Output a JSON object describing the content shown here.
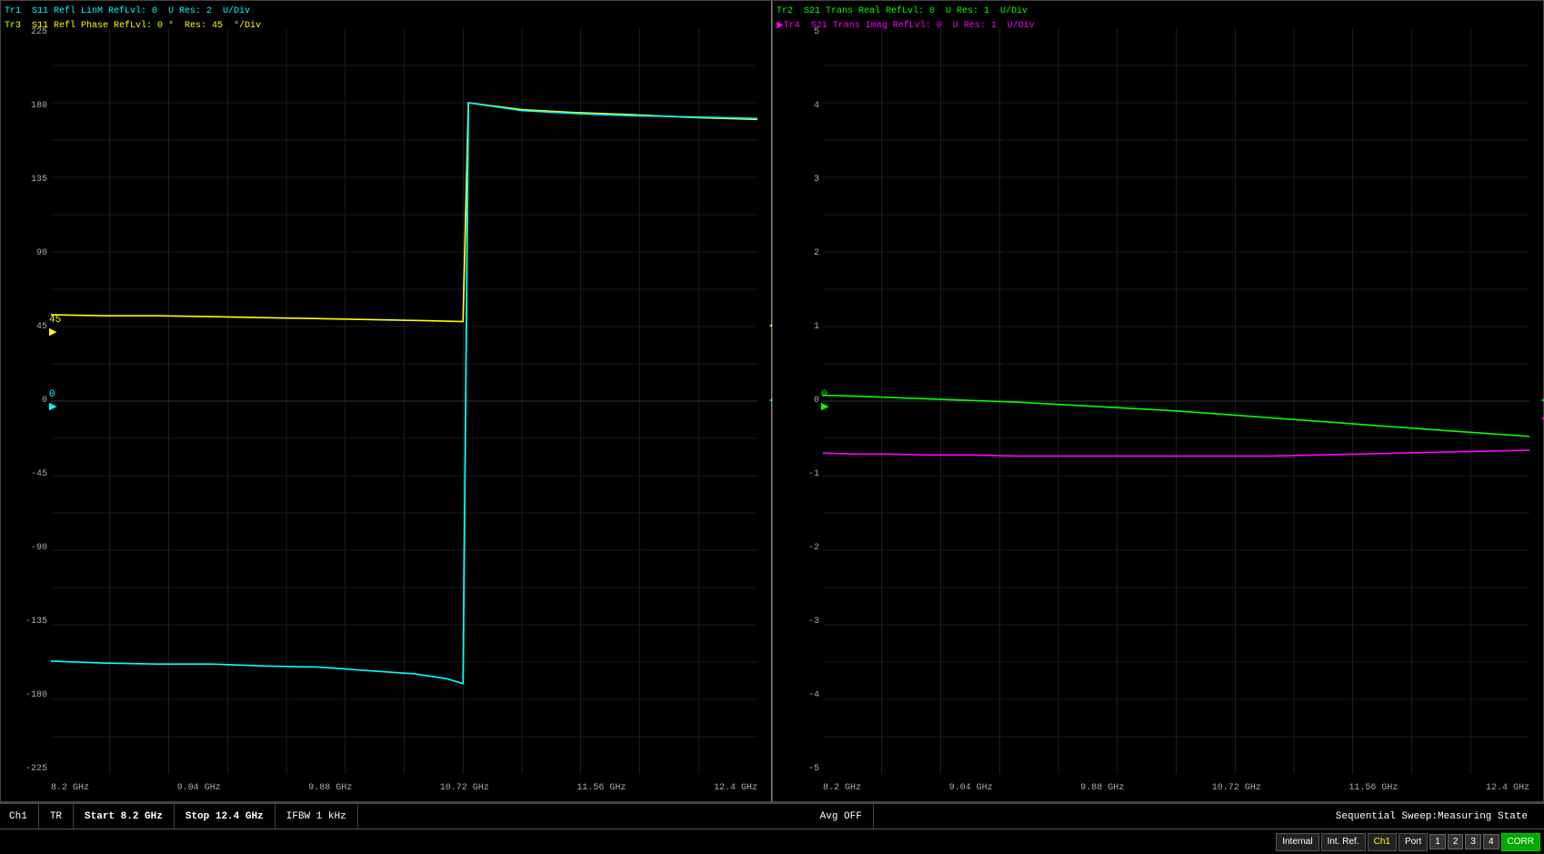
{
  "left_panel": {
    "traces": [
      {
        "id": "Tr1",
        "label": "S11 Refl LinM RefLvl: 0  U Res: 2  U/Div",
        "color": "#00ffff"
      },
      {
        "id": "Tr3",
        "label": "S11 Refl Phase RefLvl: 0 °  Res: 45  °/Div",
        "color": "#ffff00"
      }
    ],
    "y_labels": [
      "225",
      "180",
      "135",
      "90",
      "45",
      "0",
      "-45",
      "-90",
      "-135",
      "-180",
      "-225"
    ],
    "x_labels": [
      "8.2 GHz",
      "9.04 GHz",
      "9.88 GHz",
      "10.72 GHz",
      "11.56 GHz",
      "12.4 GHz"
    ],
    "ref_markers": [
      {
        "value": "45 ▶",
        "y_pct": 36,
        "color": "#ffff00"
      },
      {
        "value": "◄",
        "y_pct": 36,
        "color": "#ffff00"
      },
      {
        "value": "0 ▶",
        "y_pct": 50,
        "color": "#00ffff"
      },
      {
        "value": "◄",
        "y_pct": 50,
        "color": "#00ffff"
      }
    ]
  },
  "right_panel": {
    "traces": [
      {
        "id": "Tr2",
        "label": "S21 Trans Real RefLvl: 0  U Res: 1  U/Div",
        "color": "#00ff00"
      },
      {
        "id": "Tr4",
        "label": "S21 Trans Imag RefLvl: 0  U Res: 1  U/Div",
        "color": "#ff00ff",
        "active": true
      }
    ],
    "y_labels": [
      "5",
      "4",
      "3",
      "2",
      "1",
      "0",
      "-1",
      "-2",
      "-3",
      "-4",
      "-5"
    ],
    "x_labels": [
      "8.2 GHz",
      "9.04 GHz",
      "9.88 GHz",
      "10.72 GHz",
      "11.56 GHz",
      "12.4 GHz"
    ],
    "ref_markers": [
      {
        "value": "◄",
        "y_pct": 50,
        "color": "#00ff00"
      },
      {
        "value": "◄",
        "y_pct": 50,
        "color": "#ff00ff"
      }
    ]
  },
  "status_bar": {
    "ch": "Ch1",
    "tr": "TR",
    "start": "Start 8.2 GHz",
    "stop": "Stop 12.4 GHz",
    "ifbw": "IFBW 1 kHz",
    "avg": "Avg OFF",
    "sweep_state": "Sequential Sweep:Measuring State"
  },
  "bottom_bar": {
    "buttons": [
      "Internal",
      "Int. Ref.",
      "Ch1",
      "Port",
      "1",
      "2",
      "3",
      "4"
    ],
    "corr_label": "CORR"
  }
}
